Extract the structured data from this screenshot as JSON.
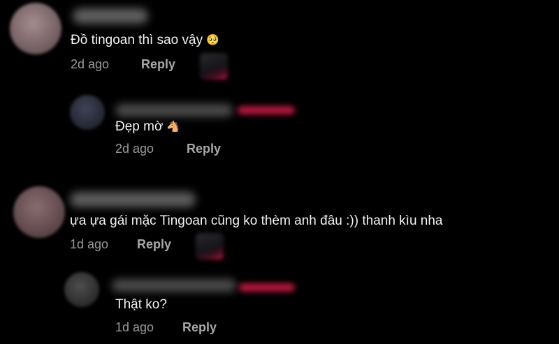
{
  "comments": [
    {
      "text": "Đồ tingoan thì sao vậy",
      "emoji": "🥺",
      "time": "2d ago",
      "reply_label": "Reply",
      "reply": {
        "text": "Đẹp mờ",
        "emoji": "🐴",
        "time": "2d ago",
        "reply_label": "Reply"
      }
    },
    {
      "text": "ựa ựa gái mặc Tingoan cũng ko thèm anh đâu :)) thanh kìu nha",
      "time": "1d ago",
      "reply_label": "Reply",
      "reply": {
        "text": "Thật ko?",
        "time": "1d ago",
        "reply_label": "Reply"
      }
    }
  ],
  "colors": {
    "background": "#000000",
    "text": "#f3f3f3",
    "meta": "#9a9a9a",
    "accent_pink": "#c01947"
  }
}
